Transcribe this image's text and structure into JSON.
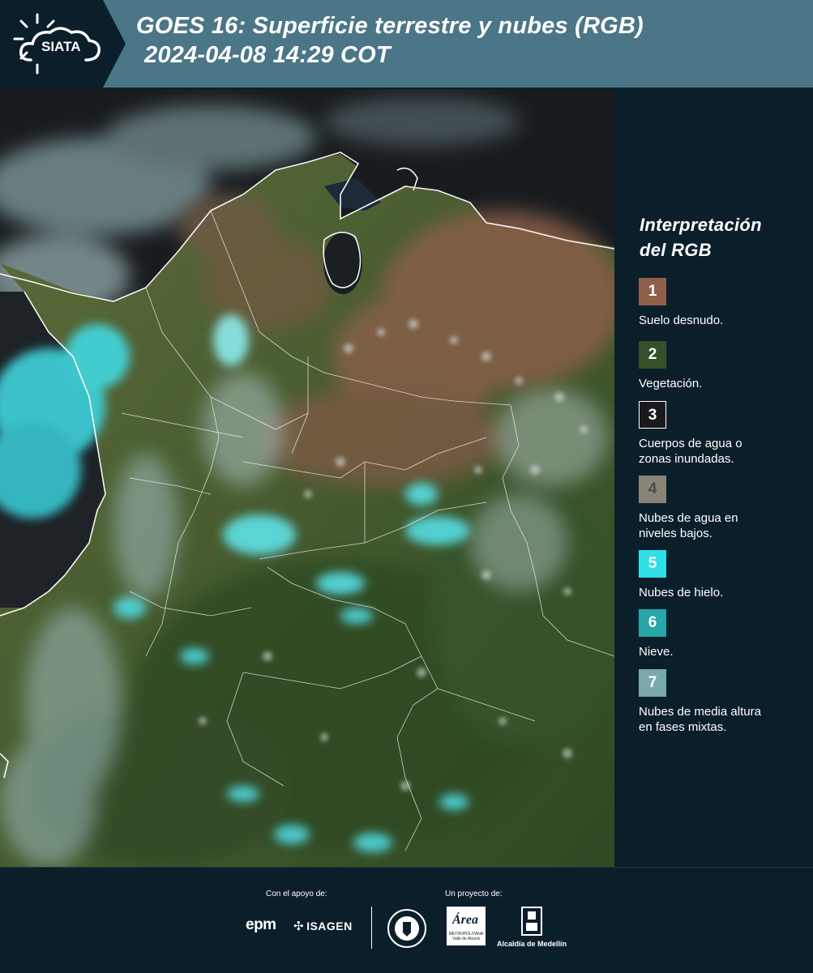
{
  "header": {
    "logo_text": "SIATA",
    "title_line1": "GOES 16: Superficie terrestre y nubes (RGB)",
    "title_line2": "2024-04-08 14:29 COT",
    "bar_color": "#4b7688",
    "logo_bg_color": "#0b1f2b"
  },
  "map": {
    "image": "satellite-rgb-composite",
    "region": "Colombia"
  },
  "legend": {
    "title_line1": "Interpretación",
    "title_line2": "del RGB",
    "items": [
      {
        "number": "1",
        "label_line1": "Suelo desnudo.",
        "label_line2": "",
        "color": "#8f5f4a"
      },
      {
        "number": "2",
        "label_line1": "Vegetación.",
        "label_line2": "",
        "color": "#35502a"
      },
      {
        "number": "3",
        "label_line1": "Cuerpos de agua o",
        "label_line2": "zonas inundadas.",
        "color": "#1a1a1e"
      },
      {
        "number": "4",
        "label_line1": "Nubes de agua en",
        "label_line2": "niveles bajos.",
        "color": "#8a8478"
      },
      {
        "number": "5",
        "label_line1": "Nubes de hielo.",
        "label_line2": "",
        "color": "#2ee0e6"
      },
      {
        "number": "6",
        "label_line1": "Nieve.",
        "label_line2": "",
        "color": "#28a6aa"
      },
      {
        "number": "7",
        "label_line1": "Nubes de media altura",
        "label_line2": "en fases mixtas.",
        "color": "#7aa9ac"
      }
    ]
  },
  "footer": {
    "support_label": "Con el apoyo de:",
    "project_label": "Un proyecto de:",
    "sponsor_1": "epm",
    "sponsor_2": "ISAGEN",
    "area_metro_mark": "Área",
    "area_metro_text": "METROPOLITANA Valle de Aburrá",
    "alcaldia": "Alcaldía de Medellín"
  }
}
